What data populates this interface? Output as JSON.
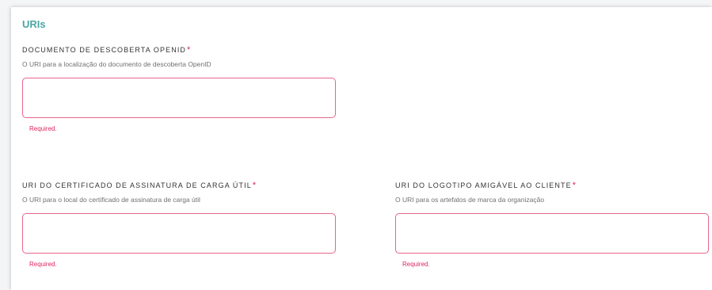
{
  "section": {
    "title": "URIs"
  },
  "fields": {
    "openid_doc": {
      "label": "DOCUMENTO DE DESCOBERTA OPENID",
      "required_mark": "*",
      "description": "O URI para a localização do documento de descoberta OpenID",
      "value": "",
      "error": "Required."
    },
    "payload_cert": {
      "label": "URI DO CERTIFICADO DE ASSINATURA DE CARGA ÚTIL",
      "required_mark": "*",
      "description": "O URI para o local do certificado de assinatura de carga útil",
      "value": "",
      "error": "Required."
    },
    "logo_uri": {
      "label": "URI DO LOGOTIPO AMIGÁVEL AO CLIENTE",
      "required_mark": "*",
      "description": "O URI para os artefatos de marca da organização",
      "value": "",
      "error": "Required."
    }
  },
  "colors": {
    "accent": "#4aa7a3",
    "error": "#e0245e",
    "input_border_error": "#e5668a"
  }
}
